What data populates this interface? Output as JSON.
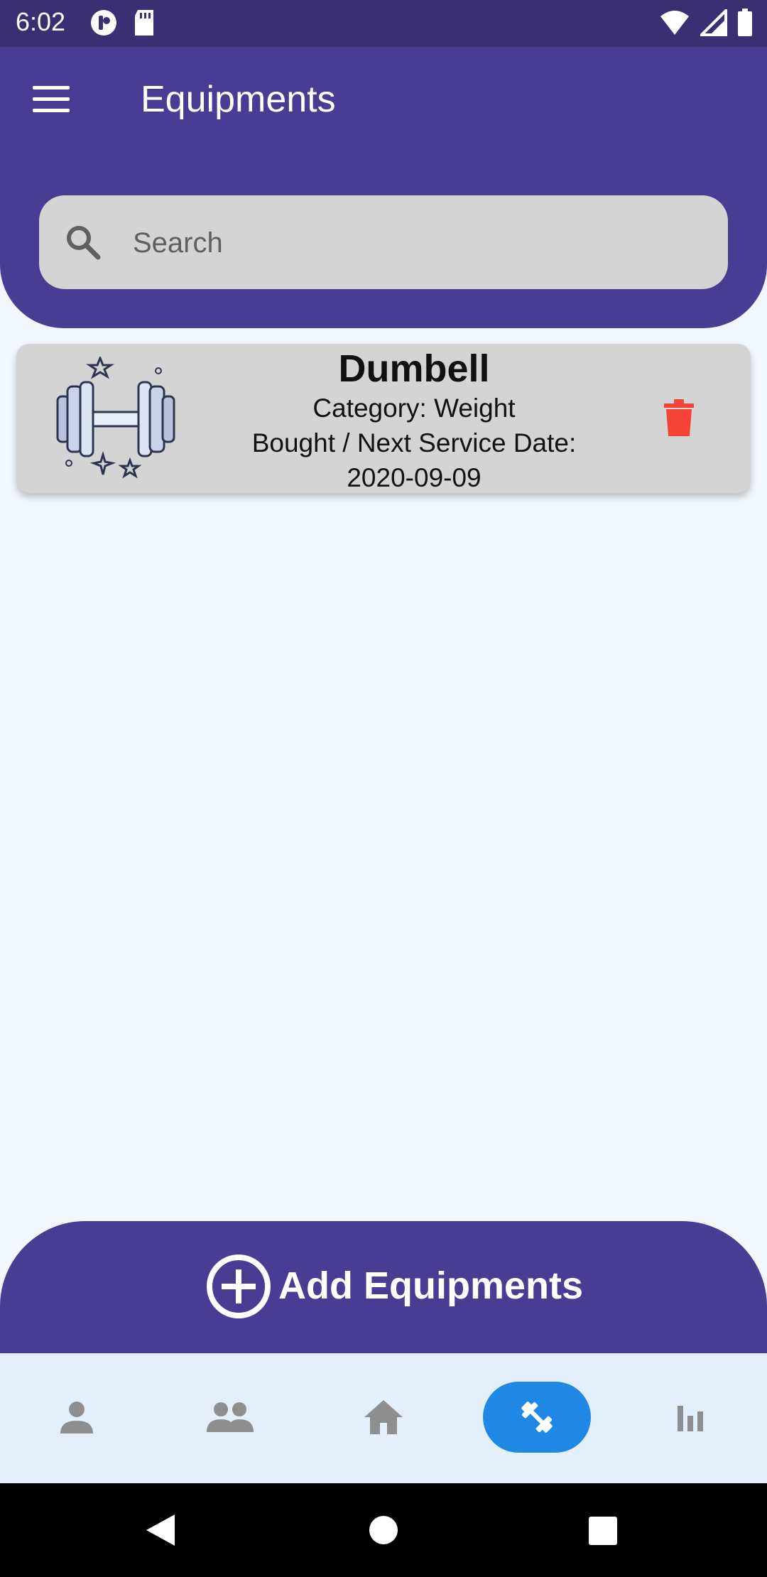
{
  "status_bar": {
    "time": "6:02",
    "icons": [
      "notification-app-icon",
      "sd-card-icon",
      "wifi-icon",
      "signal-icon",
      "battery-icon"
    ]
  },
  "header": {
    "title": "Equipments",
    "menu_icon": "hamburger-menu-icon",
    "background_color": "#483d92"
  },
  "search": {
    "placeholder": "Search",
    "value": "",
    "icon": "search-icon"
  },
  "equipment_list": [
    {
      "name": "Dumbell",
      "category_line": "Category: Weight",
      "date_label": "Bought / Next Service Date:",
      "date_value": "2020-09-09",
      "image_icon": "dumbbell-illustration-icon",
      "delete_icon": "trash-icon",
      "delete_color": "#f44336"
    }
  ],
  "add_button": {
    "label": "Add Equipments",
    "icon": "add-circle-icon"
  },
  "bottom_nav": {
    "active_index": 3,
    "active_color": "#1f88e5",
    "items": [
      {
        "icon": "person-icon"
      },
      {
        "icon": "people-icon"
      },
      {
        "icon": "home-icon"
      },
      {
        "icon": "fitness-icon"
      },
      {
        "icon": "bar-chart-icon"
      }
    ]
  },
  "system_nav": [
    "back-icon",
    "home-circle-icon",
    "recents-icon"
  ]
}
